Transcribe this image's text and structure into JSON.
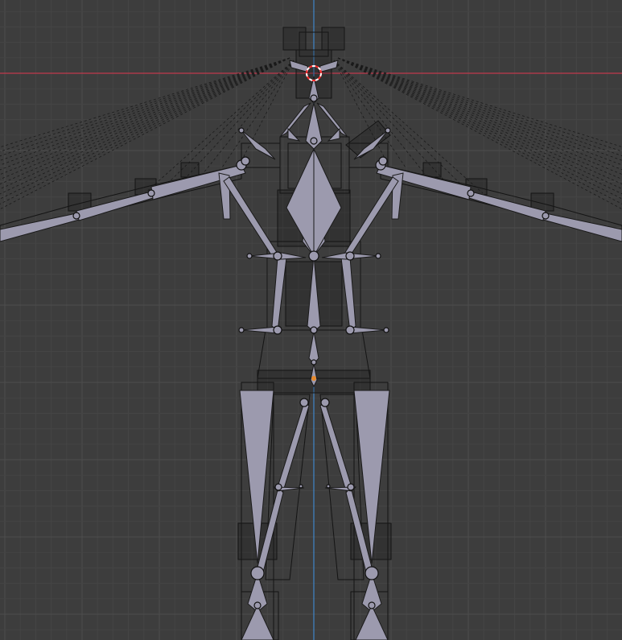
{
  "viewport": {
    "background": "#3d3d3d",
    "grid_minor_color": "#454545",
    "grid_major_color": "#4d4d4d",
    "axis_x_color": "#c0394b",
    "axis_z_color": "#3f86c9"
  },
  "scene": {
    "object": "armature",
    "display_mode": "wireframe",
    "bone_color": "#9c9aae",
    "active_point_color": "#e8892b",
    "cursor_color": "#ff2a2a"
  }
}
